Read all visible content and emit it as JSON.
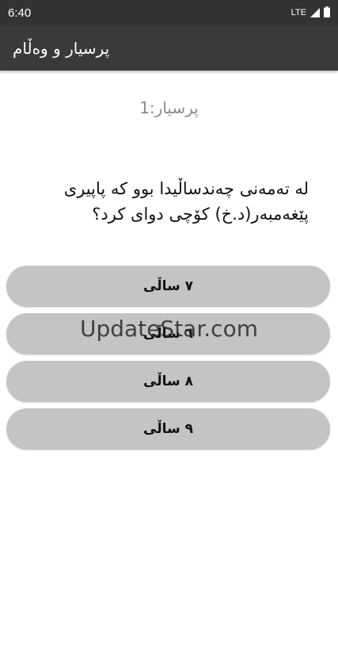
{
  "status_bar": {
    "time": "6:40",
    "network": "LTE",
    "icons": [
      "signal-icon",
      "battery-icon"
    ]
  },
  "app_bar": {
    "title": "پرسیار و وەڵام"
  },
  "quiz": {
    "question_number": "پرسیار:1",
    "question_text": "لە تەمەنی چەندساڵیدا بوو کە پاپیری پێغەمبەر(د.خ) کۆچی دوای کرد؟",
    "options": [
      {
        "label": "٧ ساڵی"
      },
      {
        "label": "٦ ساڵی"
      },
      {
        "label": "٨ ساڵی"
      },
      {
        "label": "٩ ساڵی"
      }
    ]
  },
  "watermark": "UpdateStar.com",
  "colors": {
    "status_bar": "#333333",
    "app_bar": "#3a3a3a",
    "option_bg": "#c5c3c3",
    "question_number": "#8a8a8a"
  }
}
